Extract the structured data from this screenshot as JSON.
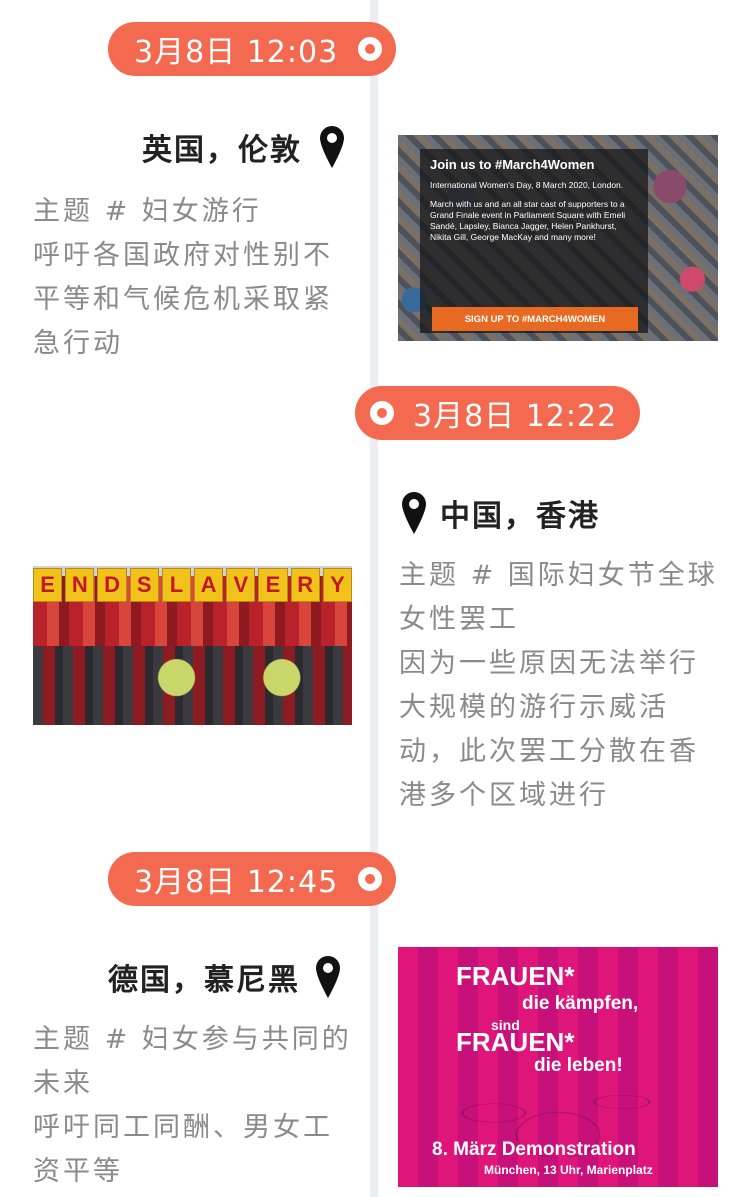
{
  "accent_color": "#f46a50",
  "events": [
    {
      "time": "3月8日 12:03",
      "city": "英国，伦敦",
      "topic": "主题 # 妇女游行",
      "desc": "呼吁各国政府对性别不平等和气候危机采取紧急行动",
      "image": {
        "headline": "Join us to #March4Women",
        "line1": "International Women's Day, 8 March 2020, London.",
        "line2": "March with us and an all star cast of supporters to a Grand Finale event in Parliament Square with Emeli Sandé, Lapsley, Bianca Jagger, Helen Pankhurst, Nikita Gill, George MacKay and many more!",
        "button": "SIGN UP TO #MARCH4WOMEN"
      }
    },
    {
      "time": "3月8日 12:22",
      "city": "中国，香港",
      "topic": "主题 # 国际妇女节全球女性罢工",
      "desc": "因为一些原因无法举行大规模的游行示威活动，此次罢工分散在香港多个区域进行",
      "image": {
        "banner_letters": [
          "E",
          "N",
          "D",
          "S",
          "L",
          "A",
          "V",
          "E",
          "R",
          "Y"
        ]
      }
    },
    {
      "time": "3月8日 12:45",
      "city": "德国，慕尼黑",
      "topic": "主题 # 妇女参与共同的未来",
      "desc": "呼吁同工同酬、男女工资平等",
      "image": {
        "l1": "FRAUEN*",
        "l2": "die kämpfen,",
        "l3": "sind",
        "l4": "FRAUEN*",
        "l5": "die leben!",
        "l6": "8. März Demonstration",
        "l7": "München, 13 Uhr, Marienplatz"
      }
    }
  ]
}
